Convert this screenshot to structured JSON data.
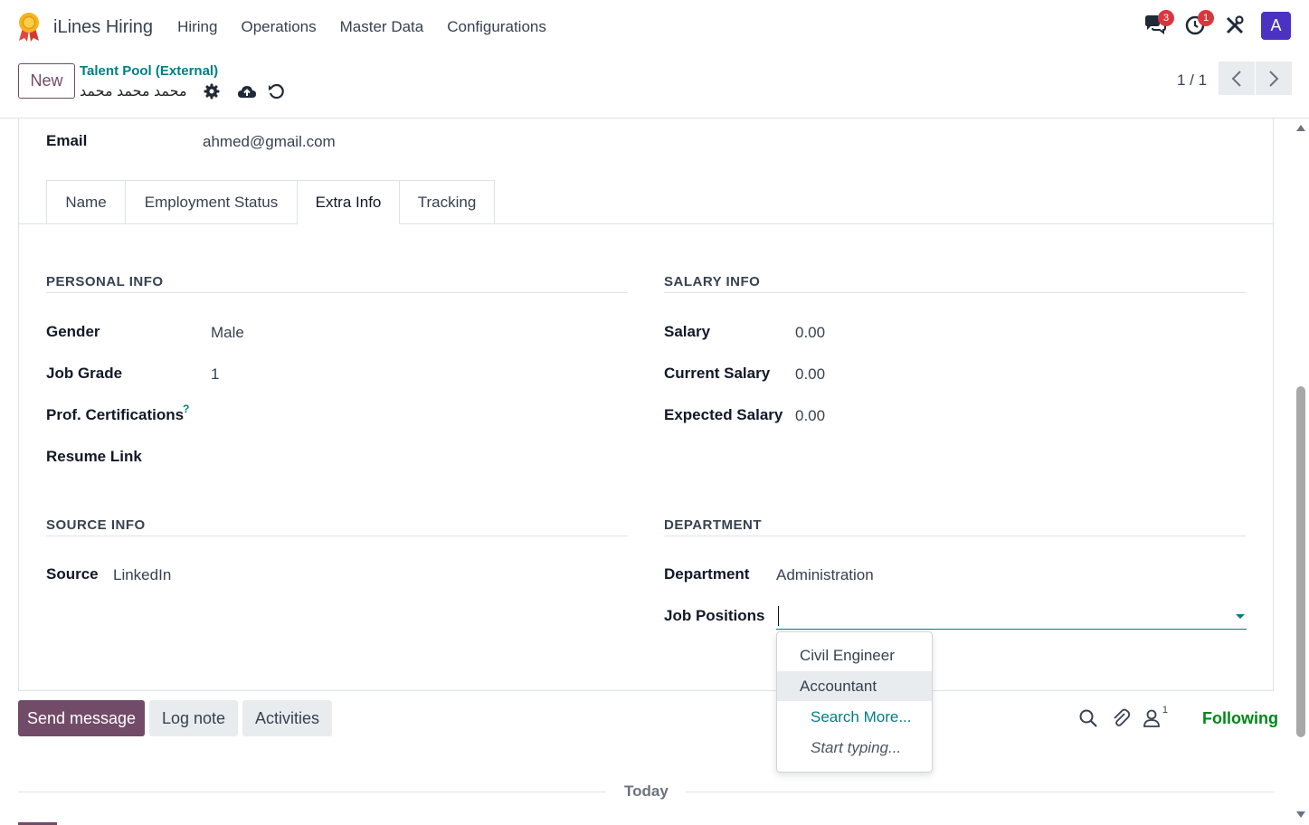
{
  "nav": {
    "app_name": "iLines Hiring",
    "menu": [
      "Hiring",
      "Operations",
      "Master Data",
      "Configurations"
    ],
    "messages_badge": "3",
    "activities_badge": "1",
    "avatar_letter": "A"
  },
  "control": {
    "new_label": "New",
    "breadcrumb_parent": "Talent Pool (External)",
    "breadcrumb_current": "محمد محمد محمد",
    "pager": "1 / 1"
  },
  "form": {
    "email_label": "Email",
    "email_value": "ahmed@gmail.com",
    "tabs": [
      "Name",
      "Employment Status",
      "Extra Info",
      "Tracking"
    ],
    "active_tab": "Extra Info",
    "personal": {
      "title": "PERSONAL INFO",
      "gender_label": "Gender",
      "gender_value": "Male",
      "grade_label": "Job Grade",
      "grade_value": "1",
      "cert_label": "Prof. Certifications",
      "cert_help": "?",
      "resume_label": "Resume Link"
    },
    "salary": {
      "title": "SALARY INFO",
      "salary_label": "Salary",
      "salary_value": "0.00",
      "current_label": "Current Salary",
      "current_value": "0.00",
      "expected_label": "Expected Salary",
      "expected_value": "0.00"
    },
    "source": {
      "title": "SOURCE INFO",
      "source_label": "Source",
      "source_value": "LinkedIn"
    },
    "department": {
      "title": "DEPARTMENT",
      "dept_label": "Department",
      "dept_value": "Administration",
      "jobs_label": "Job Positions",
      "jobs_value": ""
    }
  },
  "dropdown": {
    "options": [
      "Civil Engineer",
      "Accountant"
    ],
    "search_more": "Search More...",
    "start_typing": "Start typing..."
  },
  "chatter": {
    "send_message": "Send message",
    "log_note": "Log note",
    "activities": "Activities",
    "followers_count": "1",
    "following": "Following",
    "today": "Today"
  },
  "colors": {
    "primary": "#714b67",
    "link": "#017e84",
    "following": "#008818",
    "badge": "#d9363e",
    "avatar": "#4b32c3"
  }
}
